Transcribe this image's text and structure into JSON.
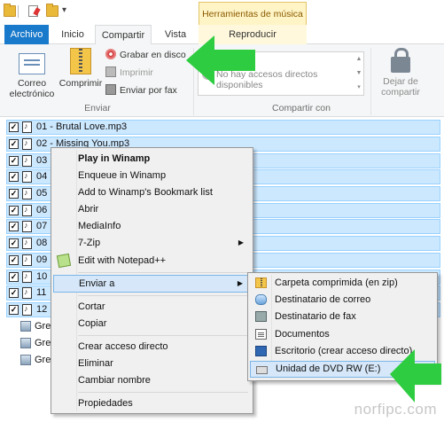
{
  "ribbon_tabs": {
    "file": "Archivo",
    "home": "Inicio",
    "share": "Compartir",
    "view": "Vista",
    "play": "Reproducir",
    "contextual_group": "Herramientas de música"
  },
  "ribbon": {
    "send_group": {
      "label": "Enviar",
      "email": "Correo\nelectrónico",
      "zip": "Comprimir",
      "burn": "Grabar en disco",
      "print": "Imprimir",
      "fax": "Enviar por fax"
    },
    "share_group": {
      "label": "Compartir con",
      "empty_text": "No hay accesos directos disponibles",
      "stop_sharing": "Dejar de\ncompartir"
    }
  },
  "files": [
    {
      "name": "01 - Brutal Love.mp3",
      "checked": true
    },
    {
      "name": "02 - Missing You.mp3",
      "checked": true
    },
    {
      "name": "03",
      "checked": true
    },
    {
      "name": "04",
      "checked": true
    },
    {
      "name": "05",
      "checked": true
    },
    {
      "name": "06",
      "checked": true
    },
    {
      "name": "07",
      "checked": true
    },
    {
      "name": "08",
      "checked": true
    },
    {
      "name": "09",
      "checked": true
    },
    {
      "name": "10",
      "checked": true
    },
    {
      "name": "11",
      "checked": true
    },
    {
      "name": "12",
      "checked": true
    }
  ],
  "other_items": [
    "Gre",
    "Gre",
    "Gre"
  ],
  "context_menu": {
    "play_winamp": "Play in Winamp",
    "enqueue_winamp": "Enqueue in Winamp",
    "bookmark_winamp": "Add to Winamp's Bookmark list",
    "open": "Abrir",
    "mediainfo": "MediaInfo",
    "sevenzip": "7-Zip",
    "notepadpp": "Edit with Notepad++",
    "send_to": "Enviar a",
    "cut": "Cortar",
    "copy": "Copiar",
    "create_shortcut": "Crear acceso directo",
    "delete": "Eliminar",
    "rename": "Cambiar nombre",
    "properties": "Propiedades"
  },
  "send_to_menu": {
    "zip_folder": "Carpeta comprimida (en zip)",
    "mail_recipient": "Destinatario de correo",
    "fax_recipient": "Destinatario de fax",
    "documents": "Documentos",
    "desktop": "Escritorio (crear acceso directo)",
    "dvd_drive": "Unidad de DVD RW (E:)"
  },
  "watermark": "norfipc.com",
  "colors": {
    "file_tab": "#1979ca",
    "selection": "#cce8ff",
    "selection_border": "#99d1ff",
    "menu_highlight": "#d5e7f8",
    "arrow": "#2ecc40"
  }
}
